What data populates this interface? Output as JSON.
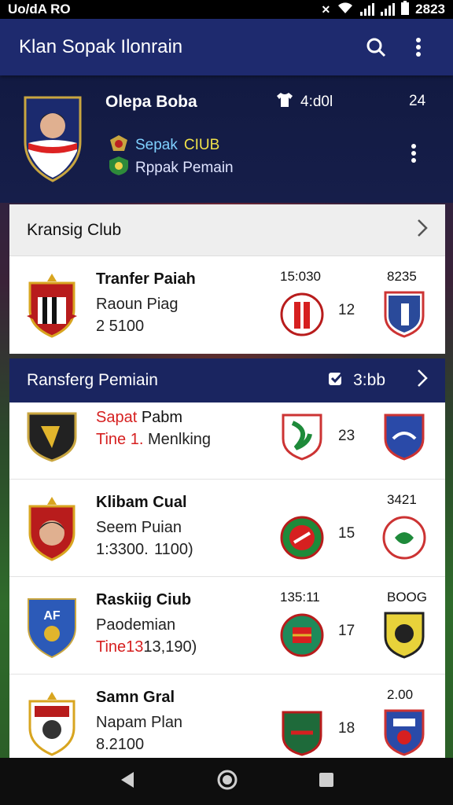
{
  "status_bar": {
    "left": "Uo/dA RO",
    "time": "2823"
  },
  "app_bar": {
    "title": "Klan Sopak Ilonrain",
    "icons": [
      "search-icon",
      "more-vert-icon"
    ]
  },
  "profile": {
    "name": "Olepa Boba",
    "stat_label": "4:d0l",
    "stat_number": "24",
    "club_part1": "Sepak",
    "club_part2": "CIUB",
    "position": "Rppak Pemain"
  },
  "section1": {
    "title": "Kransig Club",
    "row": {
      "name": "Tranfer Paiah",
      "sub": "Raoun Piag",
      "value": "2 5100",
      "time": "15:030",
      "score": "12",
      "right_num": "8235"
    }
  },
  "section2": {
    "title": "Ransferg Pemiain",
    "badge_text": "3:bb",
    "rows": [
      {
        "name_red": "Sapat",
        "name_rest": "Pabm",
        "sub_red": "Tine 1.",
        "sub_rest": "Menlking",
        "score": "23"
      },
      {
        "name": "Klibam Cual",
        "sub": "Seem Puian",
        "value": "1:3300.  1100)",
        "score": "15",
        "right_num": "3421"
      },
      {
        "name": "Raskiig Ciub",
        "sub": "Paodemian",
        "value_red": "Tine13",
        "value_rest": "13,190)",
        "time": "135:11",
        "score": "17",
        "right_num": "BOOG"
      },
      {
        "name": "Samn Gral",
        "sub": "Napam Plan",
        "value": "8.2100",
        "score": "18",
        "right_num": "2.00"
      }
    ]
  },
  "colors": {
    "app_bar": "#1e2a6e",
    "dark_header": "#1a2560",
    "accent_red": "#d62020"
  }
}
